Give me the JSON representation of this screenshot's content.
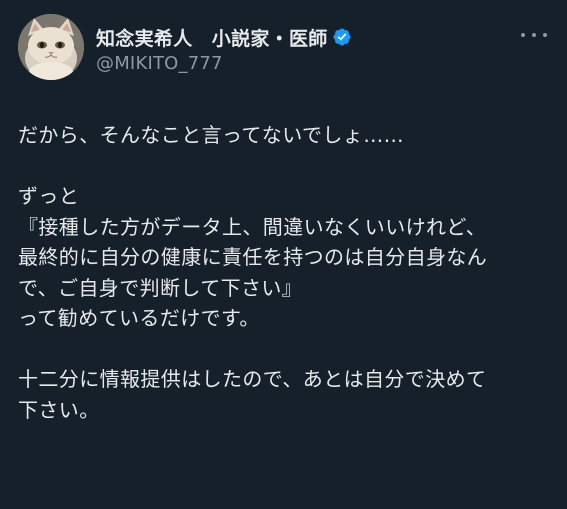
{
  "author": {
    "display_name": "知念実希人　小説家・医師",
    "handle": "@MIKITO_777",
    "verified": true,
    "verified_color": "#1d9bf0"
  },
  "more_icon": "ellipsis-icon",
  "tweet": {
    "lines": [
      "だから、そんなこと言ってないでしょ……",
      "",
      "ずっと",
      "『接種した方がデータ上、間違いなくいいけれど、",
      "最終的に自分の健康に責任を持つのは自分自身なん",
      "で、ご自身で判断して下さい』",
      "って勧めているだけです。",
      "",
      "十二分に情報提供はしたので、あとは自分で決めて",
      "下さい。"
    ]
  },
  "colors": {
    "background": "#15202b",
    "text": "#e7e9ea",
    "secondary": "#8b98a5"
  }
}
